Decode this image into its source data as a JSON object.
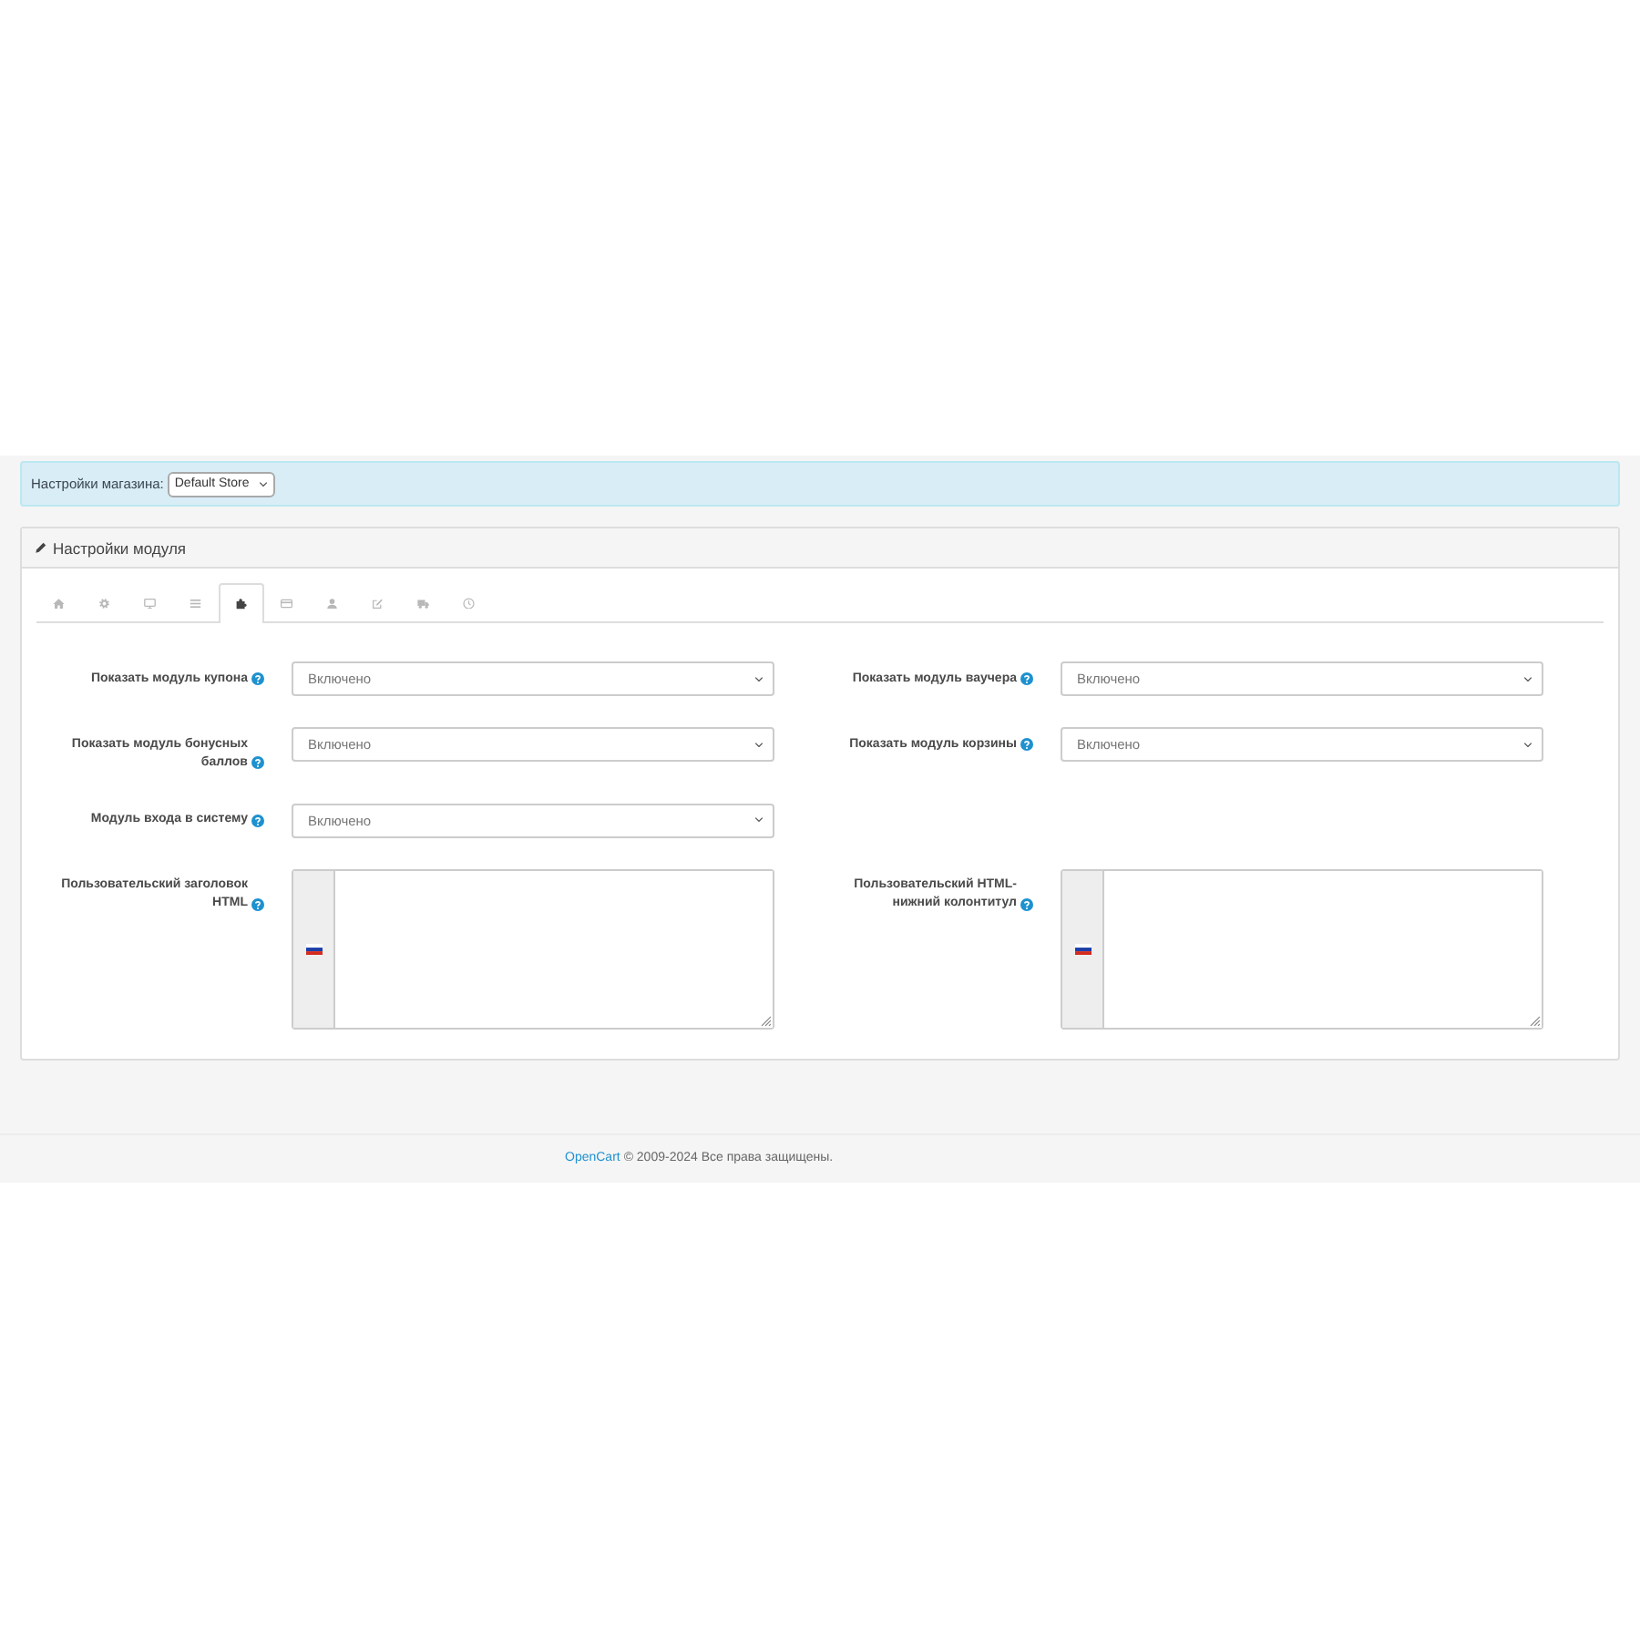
{
  "store_bar": {
    "label": "Настройки магазина:",
    "store": "Default Store"
  },
  "panel": {
    "title": "Настройки модуля"
  },
  "tabs": [
    {
      "kind": "home",
      "selected": false
    },
    {
      "kind": "gear",
      "selected": false
    },
    {
      "kind": "monitor",
      "selected": false
    },
    {
      "kind": "list",
      "selected": false
    },
    {
      "kind": "puzzle",
      "selected": true
    },
    {
      "kind": "card",
      "selected": false
    },
    {
      "kind": "user",
      "selected": false
    },
    {
      "kind": "edit",
      "selected": false
    },
    {
      "kind": "truck",
      "selected": false
    },
    {
      "kind": "clock",
      "selected": false
    }
  ],
  "form_rows": [
    {
      "fields": [
        {
          "kind": "select",
          "label": "Показать модуль купона",
          "value": "Включено"
        },
        {
          "kind": "select",
          "label": "Показать модуль ваучера",
          "value": "Включено"
        }
      ]
    },
    {
      "fields": [
        {
          "kind": "select",
          "label": "Показать модуль бонусных баллов",
          "value": "Включено"
        },
        {
          "kind": "select",
          "label": "Показать модуль корзины",
          "value": "Включено"
        }
      ]
    },
    {
      "fields": [
        {
          "kind": "select",
          "label": "Модуль входа в систему",
          "value": "Включено"
        }
      ]
    },
    {
      "fields": [
        {
          "kind": "textarea",
          "label": "Пользовательский заголовок HTML"
        },
        {
          "kind": "textarea",
          "label": "Пользовательский HTML-нижний колонтитул"
        }
      ]
    }
  ],
  "footer": {
    "link": "OpenCart",
    "text": "© 2009-2024 Все права защищены."
  }
}
